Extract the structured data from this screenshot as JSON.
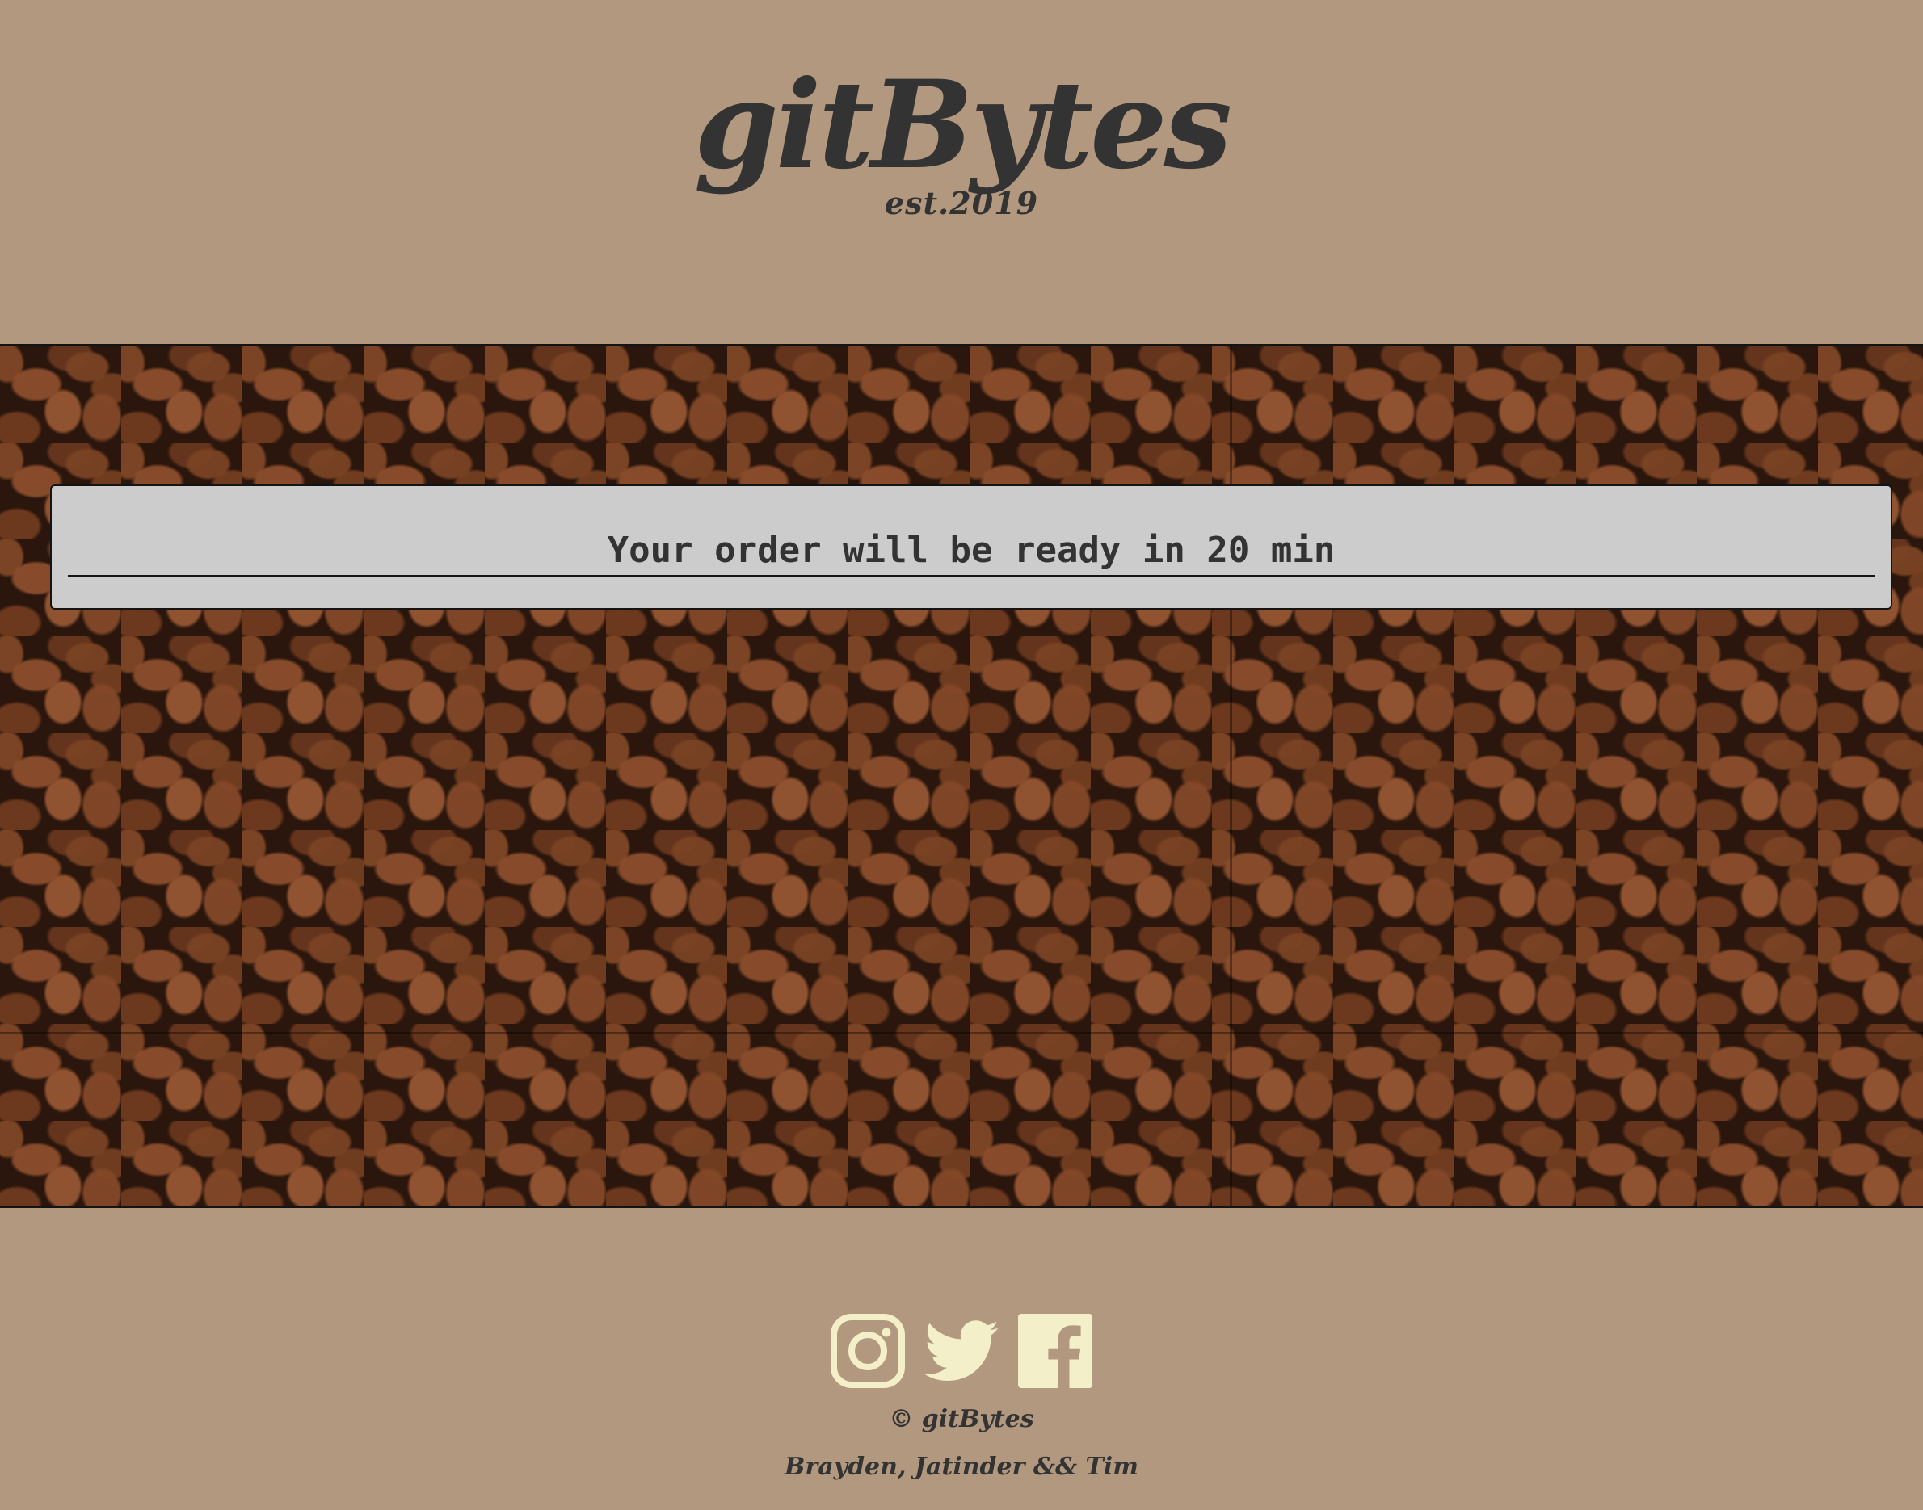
{
  "header": {
    "brand_name": "gitBytes",
    "established": "est.2019"
  },
  "hero": {
    "background_image": "coffee beans"
  },
  "order": {
    "message": "Your order will be ready in 20 min"
  },
  "footer": {
    "social_icons": [
      "instagram-icon",
      "twitter-icon",
      "facebook-icon"
    ],
    "copyright": "© gitBytes",
    "authors": "Brayden, Jatinder && Tim"
  },
  "colors": {
    "page_background": "#b2987f",
    "text_dark": "#333333",
    "panel_background": "#cccccc",
    "icon_cream": "#f3efc9"
  }
}
